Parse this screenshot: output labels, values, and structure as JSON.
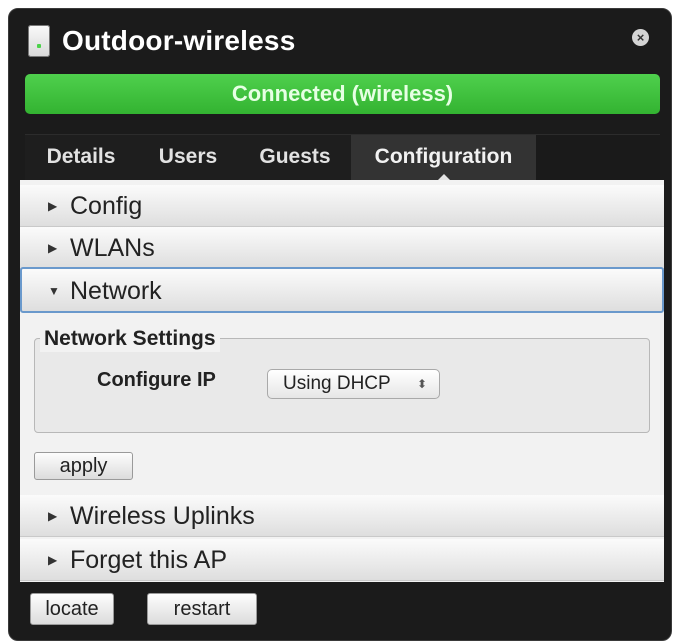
{
  "window": {
    "title": "Outdoor-wireless",
    "device_icon": "access-point-icon",
    "close_icon": "close-icon",
    "close_glyph": "×"
  },
  "status": {
    "text": "Connected (wireless)",
    "color": "#3cc23a"
  },
  "tabs": [
    {
      "label": "Details",
      "active": false
    },
    {
      "label": "Users",
      "active": false
    },
    {
      "label": "Guests",
      "active": false
    },
    {
      "label": "Configuration",
      "active": true
    }
  ],
  "sections": [
    {
      "label": "Config",
      "expanded": false
    },
    {
      "label": "WLANs",
      "expanded": false
    },
    {
      "label": "Network",
      "expanded": true
    },
    {
      "label": "Wireless Uplinks",
      "expanded": false
    },
    {
      "label": "Forget this AP",
      "expanded": false
    }
  ],
  "arrows": {
    "collapsed": "▶",
    "expanded": "▼"
  },
  "network": {
    "legend": "Network Settings",
    "configure_ip_label": "Configure IP",
    "configure_ip_value": "Using DHCP",
    "select_caret": "⬍",
    "apply_label": "apply"
  },
  "footer": {
    "locate_label": "locate",
    "restart_label": "restart"
  },
  "colors": {
    "accent_focus": "#6a99cc",
    "tab_bar": "#1a1a1a"
  }
}
